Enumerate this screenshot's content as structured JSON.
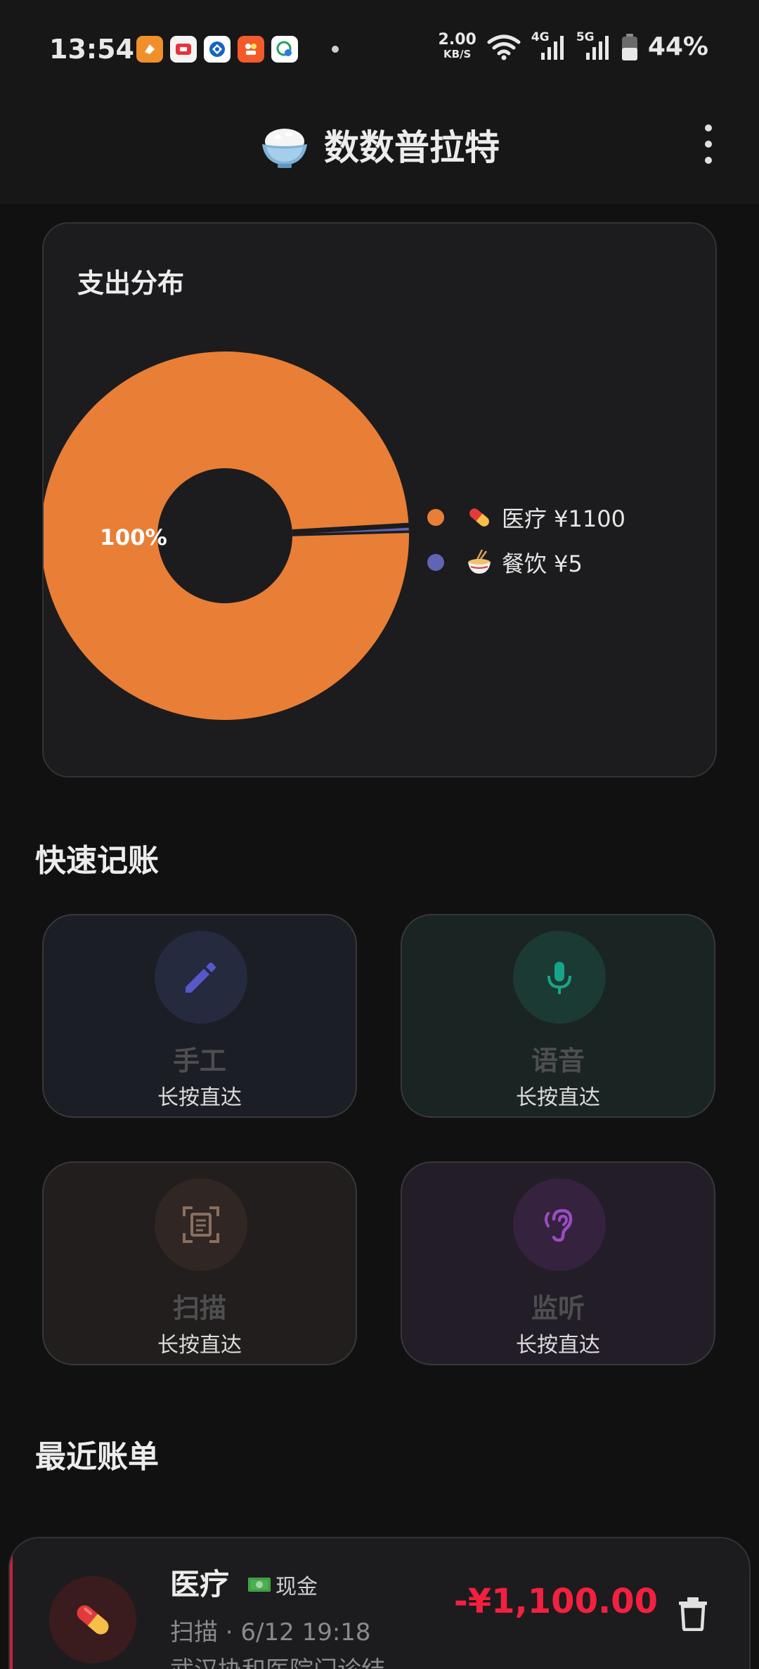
{
  "status_bar": {
    "time": "13:54",
    "speed_value": "2.00",
    "speed_unit": "KB/S",
    "network_1": "4G",
    "network_2": "5G",
    "battery": "44%"
  },
  "header": {
    "title": "数数普拉特",
    "emoji_icon": "rice-bowl-icon"
  },
  "chart_card": {
    "title": "支出分布"
  },
  "chart_data": {
    "type": "pie",
    "title": "支出分布",
    "donut": true,
    "center_label": "100%",
    "legend_placement": "right",
    "categories": [
      "医疗",
      "餐饮"
    ],
    "values": [
      1100,
      5
    ],
    "legend_labels": [
      "医疗 ¥1100",
      "餐饮 ¥5"
    ],
    "colors": [
      "#e97e36",
      "#6163b5"
    ]
  },
  "quick": {
    "title": "快速记账",
    "tiles": [
      {
        "label": "手工",
        "sub": "长按直达",
        "icon": "pencil-icon",
        "color": "#5558c8"
      },
      {
        "label": "语音",
        "sub": "长按直达",
        "icon": "microphone-icon",
        "color": "#17a48a"
      },
      {
        "label": "扫描",
        "sub": "长按直达",
        "icon": "scan-document-icon",
        "color": "#8a6f5e"
      },
      {
        "label": "监听",
        "sub": "长按直达",
        "icon": "ear-icon",
        "color": "#9a4dc0"
      }
    ]
  },
  "recent": {
    "title": "最近账单",
    "items": [
      {
        "category": "医疗",
        "payment": "现金",
        "meta": "扫描 · 6/12 19:18",
        "note": "武汉协和医院门诊结...",
        "amount": "-¥1,100.00"
      }
    ]
  },
  "colors": {
    "background": "#111112",
    "card": "#1c1c1e",
    "expense": "#f3203f"
  }
}
